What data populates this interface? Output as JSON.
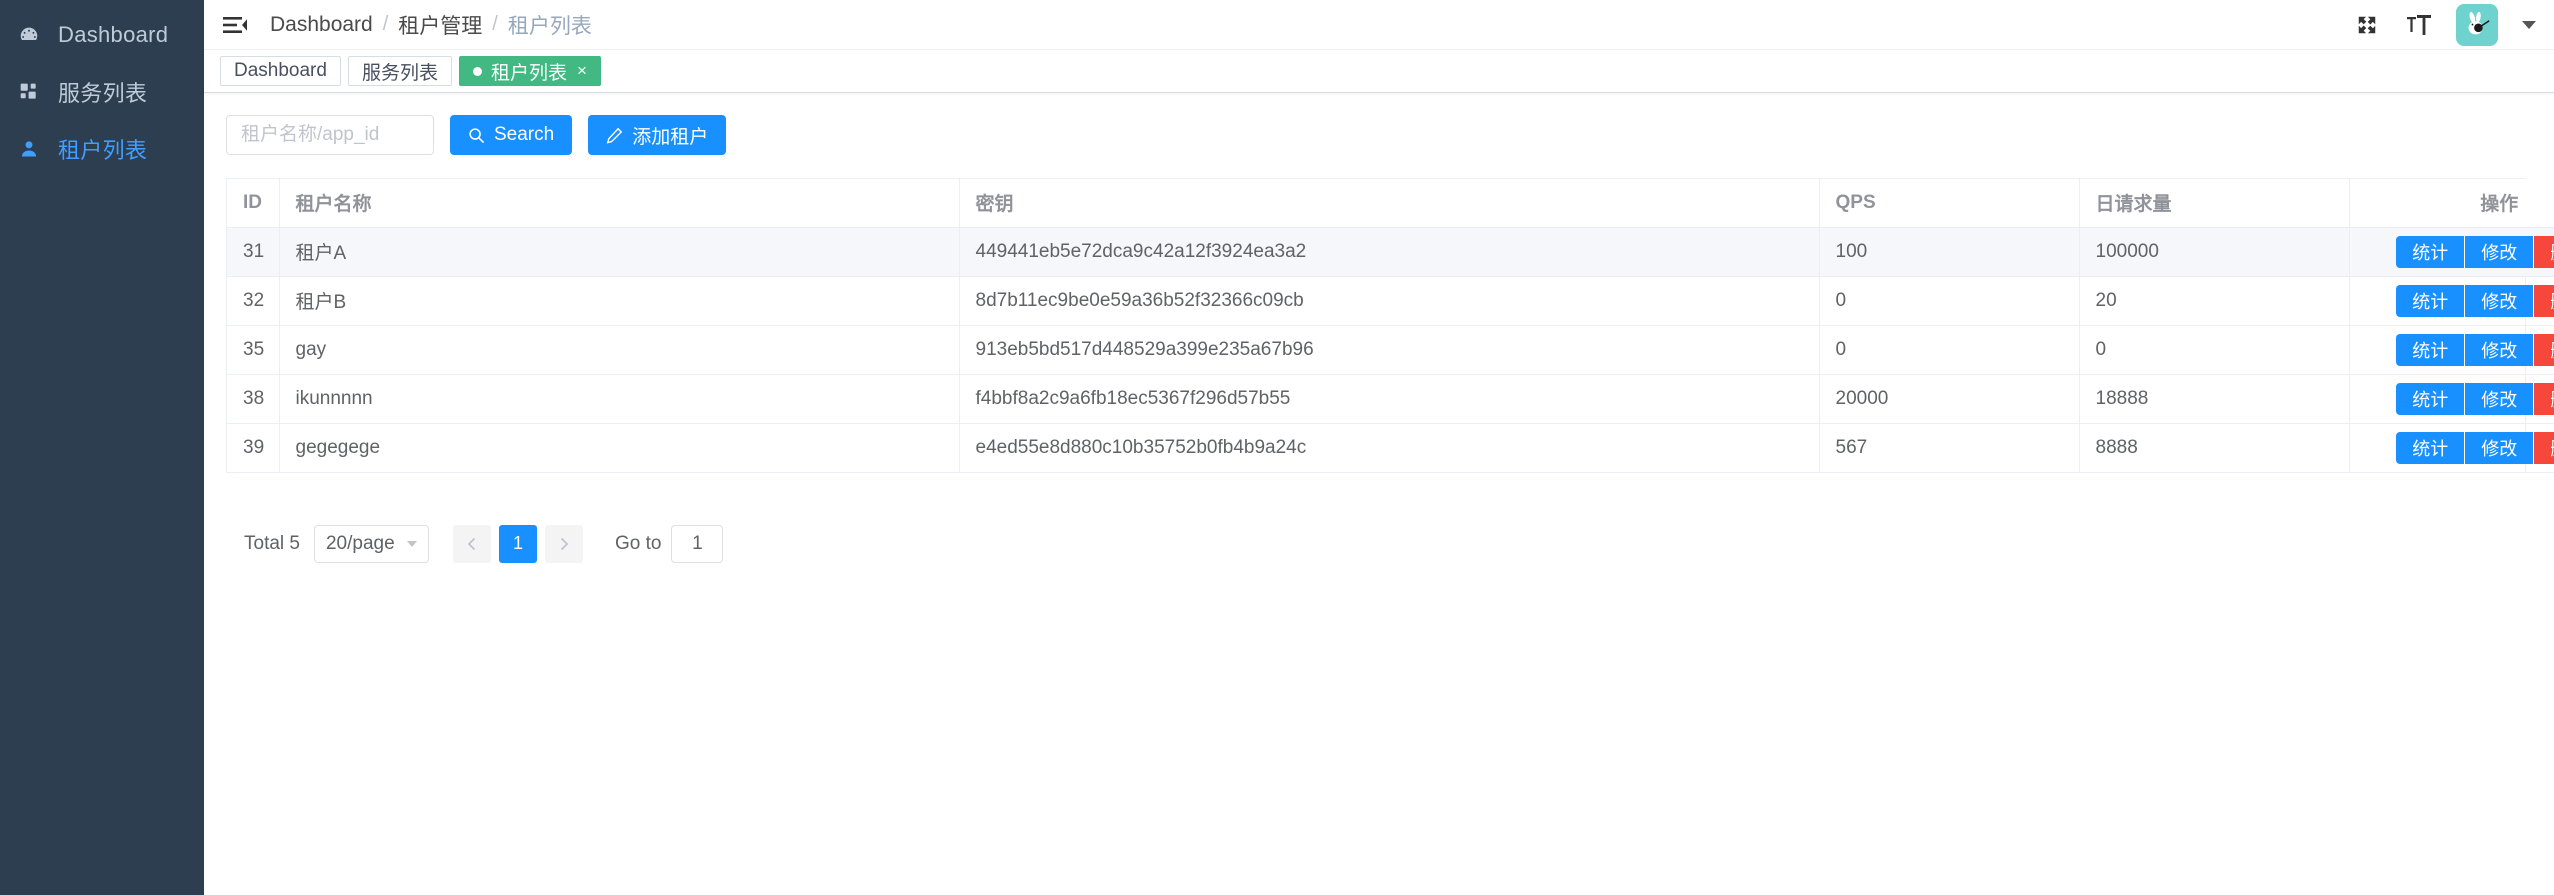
{
  "sidebar": {
    "items": [
      {
        "label": "Dashboard",
        "icon": "dashboard-gauge-icon",
        "active": false
      },
      {
        "label": "服务列表",
        "icon": "grid-icon",
        "active": false
      },
      {
        "label": "租户列表",
        "icon": "user-icon",
        "active": true
      }
    ]
  },
  "navbar": {
    "hamburger_icon": "hamburger-fold-icon",
    "breadcrumb": [
      "Dashboard",
      "租户管理",
      "租户列表"
    ],
    "breadcrumb_separator": "/",
    "right_icons": [
      "fullscreen-icon",
      "font-size-icon"
    ],
    "avatar_icon": "rabbit-avatar",
    "caret_icon": "chevron-down-icon"
  },
  "tabs": [
    {
      "label": "Dashboard",
      "active": false,
      "closable": false
    },
    {
      "label": "服务列表",
      "active": false,
      "closable": false
    },
    {
      "label": "租户列表",
      "active": true,
      "closable": true,
      "close_label": "×"
    }
  ],
  "toolbar": {
    "search_placeholder": "租户名称/app_id",
    "search_value": "",
    "search_button": "Search",
    "search_icon": "search-icon",
    "add_button": "添加租户",
    "add_icon": "edit-pencil-icon"
  },
  "table": {
    "columns": [
      "ID",
      "租户名称",
      "密钥",
      "QPS",
      "日请求量",
      "操作"
    ],
    "rows": [
      {
        "id": "31",
        "name": "租户A",
        "key": "449441eb5e72dca9c42a12f3924ea3a2",
        "qps": "100",
        "daily": "100000",
        "hover": true
      },
      {
        "id": "32",
        "name": "租户B",
        "key": "8d7b11ec9be0e59a36b52f32366c09cb",
        "qps": "0",
        "daily": "20",
        "hover": false
      },
      {
        "id": "35",
        "name": "gay",
        "key": "913eb5bd517d448529a399e235a67b96",
        "qps": "0",
        "daily": "0",
        "hover": false
      },
      {
        "id": "38",
        "name": "ikunnnnn",
        "key": "f4bbf8a2c9a6fb18ec5367f296d57b55",
        "qps": "20000",
        "daily": "18888",
        "hover": false
      },
      {
        "id": "39",
        "name": "gegegege",
        "key": "e4ed55e8d880c10b35752b0fb4b9a24c",
        "qps": "567",
        "daily": "8888",
        "hover": false
      }
    ],
    "actions": {
      "stats": "统计",
      "edit": "修改",
      "delete": "删除"
    }
  },
  "pagination": {
    "total": "Total 5",
    "page_size": "20/page",
    "prev_icon": "chevron-left-icon",
    "next_icon": "chevron-right-icon",
    "pages": [
      "1"
    ],
    "current_page": "1",
    "goto_label": "Go to",
    "goto_value": "1"
  },
  "colors": {
    "sidebar_bg": "#2c3e50",
    "sidebar_active": "#409eff",
    "tab_active": "#42b983",
    "primary": "#1890ff",
    "danger": "#f5483b",
    "avatar_bg": "#6ed3cf"
  }
}
